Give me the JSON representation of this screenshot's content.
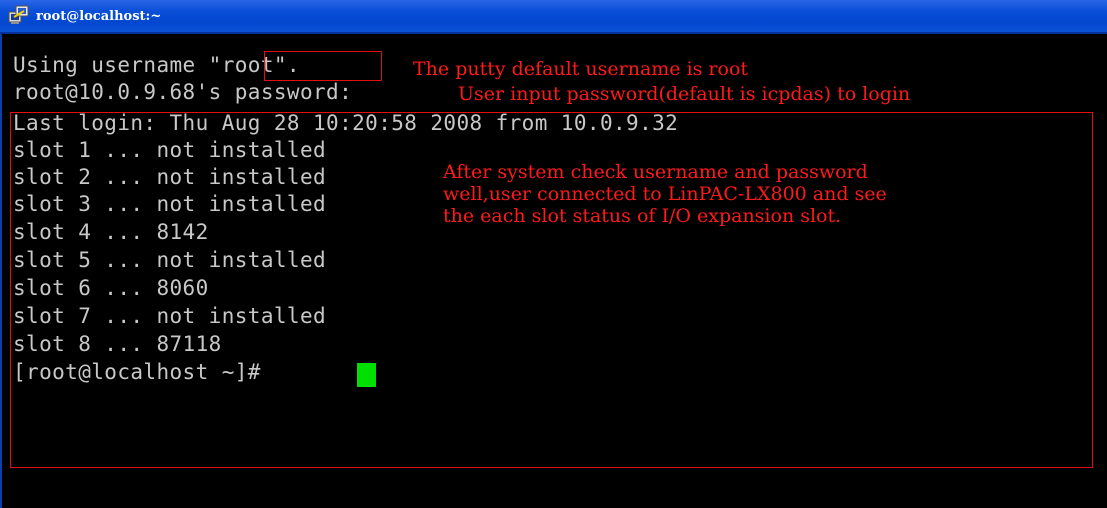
{
  "window": {
    "title": "root@localhost:~",
    "icon": "putty-icon"
  },
  "terminal": {
    "lines": [
      {
        "prefix": "Using username ",
        "user": "\"root\"",
        "suffix": "."
      },
      {
        "text": "root@10.0.9.68's password:"
      },
      {
        "text": "Last login: Thu Aug 28 10:20:58 2008 from 10.0.9.32"
      },
      {
        "text": "slot 1 ... not installed"
      },
      {
        "text": "slot 2 ... not installed"
      },
      {
        "text": "slot 3 ... not installed"
      },
      {
        "text": "slot 4 ... 8142"
      },
      {
        "text": "slot 5 ... not installed"
      },
      {
        "text": "slot 6 ... 8060"
      },
      {
        "text": "slot 7 ... not installed"
      },
      {
        "text": "slot 8 ... 87118"
      },
      {
        "text": "[root@localhost ~]# "
      }
    ],
    "cursor_color": "#00e000",
    "text_color": "#c8c8c8",
    "background": "#000000"
  },
  "annotations": {
    "username_note": "The putty default username is root",
    "password_note": "User input password(default is icpdas) to login",
    "status_note": [
      "After system check username and password",
      "well,user connected to LinPAC-LX800 and see",
      "the each slot status of I/O expansion slot."
    ],
    "color": "#ff1a1a"
  }
}
